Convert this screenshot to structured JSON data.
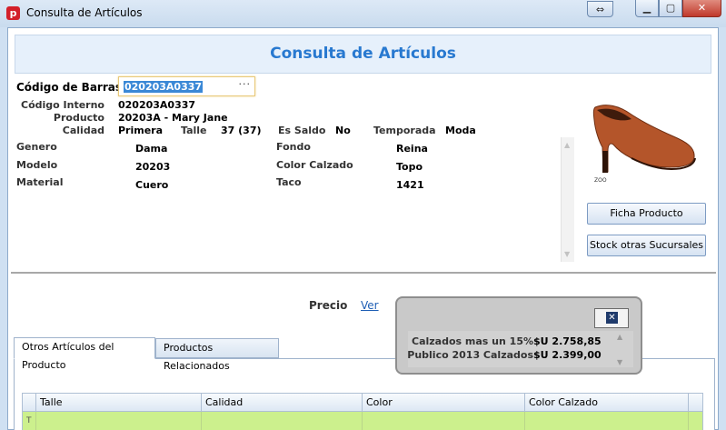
{
  "window": {
    "title": "Consulta de Artículos",
    "icon": "app-logo-icon",
    "controls": [
      "restore-icon",
      "minimize-icon",
      "maximize-icon",
      "close-icon"
    ]
  },
  "header": {
    "title": "Consulta de Artículos"
  },
  "barcode": {
    "label": "Código de Barras",
    "value": "020203A0337",
    "ellipsis": "···"
  },
  "summary": {
    "codigo_interno": {
      "label": "Código Interno",
      "value": "020203A0337"
    },
    "producto": {
      "label": "Producto",
      "value": "20203A - Mary Jane"
    },
    "calidad": {
      "label": "Calidad",
      "value": "Primera"
    },
    "talle": {
      "label": "Talle",
      "value": "37 (37)"
    },
    "es_saldo": {
      "label": "Es Saldo",
      "value": "No"
    },
    "temporada": {
      "label": "Temporada",
      "value": "Moda"
    }
  },
  "details": {
    "genero": {
      "label": "Genero",
      "value": "Dama"
    },
    "modelo": {
      "label": "Modelo",
      "value": "20203"
    },
    "material": {
      "label": "Material",
      "value": "Cuero"
    },
    "fondo": {
      "label": "Fondo",
      "value": "Reina"
    },
    "color_calzado": {
      "label": "Color Calzado",
      "value": "Topo"
    },
    "taco": {
      "label": "Taco",
      "value": "1421"
    }
  },
  "buttons": {
    "ficha": "Ficha Producto",
    "stock": "Stock otras Sucursales"
  },
  "precio": {
    "label": "Precio",
    "link": "Ver"
  },
  "price_popup": {
    "items": [
      {
        "name": "Calzados mas un 15%",
        "price": "$U 2.758,85"
      },
      {
        "name": "Publico 2013 Calzados",
        "price": "$U 2.399,00"
      }
    ]
  },
  "tabs": [
    {
      "label": "Otros Artículos del Producto",
      "active": true
    },
    {
      "label": "Productos Relacionados",
      "active": false
    }
  ],
  "grid": {
    "columns": [
      "Talle",
      "Calidad",
      "Color",
      "Color Calzado"
    ]
  },
  "colors": {
    "accent": "#2879d0",
    "row_highlight": "#ccf08d",
    "shoe": "#b4552a"
  }
}
